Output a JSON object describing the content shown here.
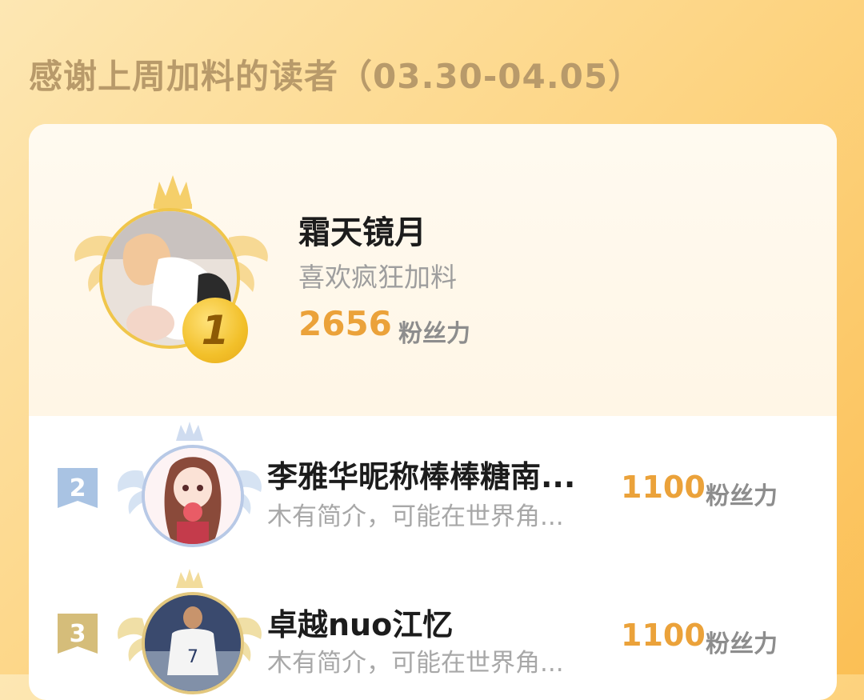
{
  "header": {
    "title": "感谢上周加料的读者（03.30-04.05）"
  },
  "leaders": [
    {
      "rank": "1",
      "name": "霜天镜月",
      "bio": "喜欢疯狂加料",
      "score": "2656",
      "unit": "粉丝力"
    },
    {
      "rank": "2",
      "name": "李雅华昵称棒棒糖南...",
      "bio": "木有简介，可能在世界角...",
      "score": "1100",
      "unit": "粉丝力"
    },
    {
      "rank": "3",
      "name": "卓越nuo江忆",
      "bio": "木有简介，可能在世界角...",
      "score": "1100",
      "unit": "粉丝力"
    }
  ],
  "colors": {
    "accent": "#eba23a",
    "gold": "#f0c64b",
    "silver": "#b8c9e6",
    "bronze": "#d5bd7a"
  },
  "icons": {
    "crown": "crown-icon",
    "wings": "laurel-wings-icon"
  }
}
